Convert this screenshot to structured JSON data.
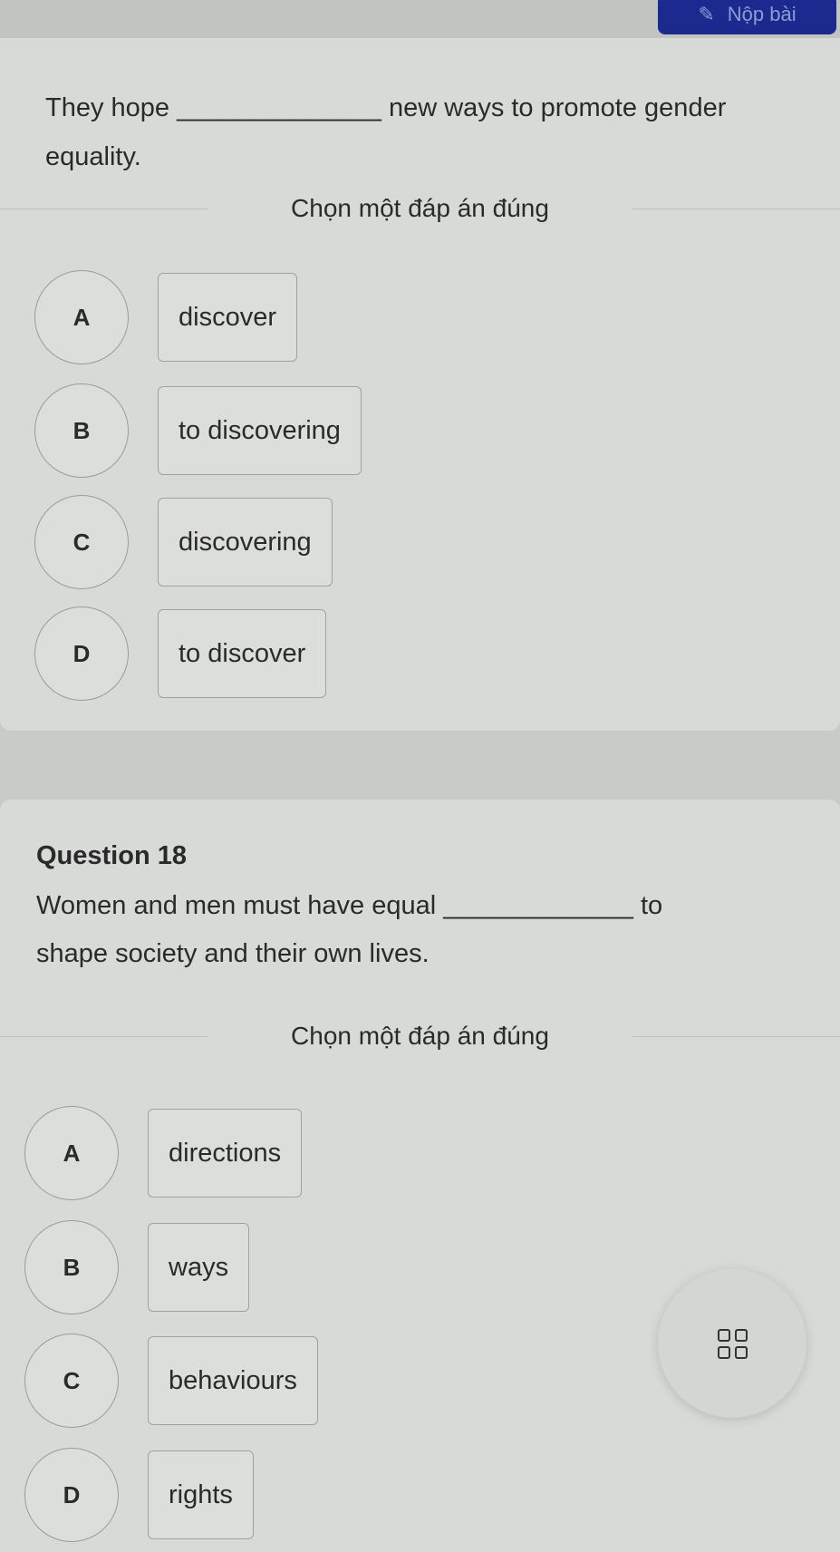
{
  "header": {
    "submit_label": "Nộp bài",
    "submit_icon": "edit-icon"
  },
  "q17": {
    "text_before": "They hope",
    "blank": "______________",
    "text_after": "new ways to promote gender",
    "text_line2": "equality.",
    "instruction": "Chọn một đáp án đúng",
    "options": [
      {
        "letter": "A",
        "text": "discover"
      },
      {
        "letter": "B",
        "text": "to discovering"
      },
      {
        "letter": "C",
        "text": "discovering"
      },
      {
        "letter": "D",
        "text": "to discover"
      }
    ]
  },
  "q18": {
    "title": "Question 18",
    "text_before": "Women and men must have equal",
    "blank": "_____________",
    "text_after": "to",
    "text_line2": "shape society and their own lives.",
    "instruction": "Chọn một đáp án đúng",
    "options": [
      {
        "letter": "A",
        "text": "directions"
      },
      {
        "letter": "B",
        "text": "ways"
      },
      {
        "letter": "C",
        "text": "behaviours"
      },
      {
        "letter": "D",
        "text": "rights"
      }
    ]
  },
  "fab": {
    "icon": "grid-icon"
  }
}
